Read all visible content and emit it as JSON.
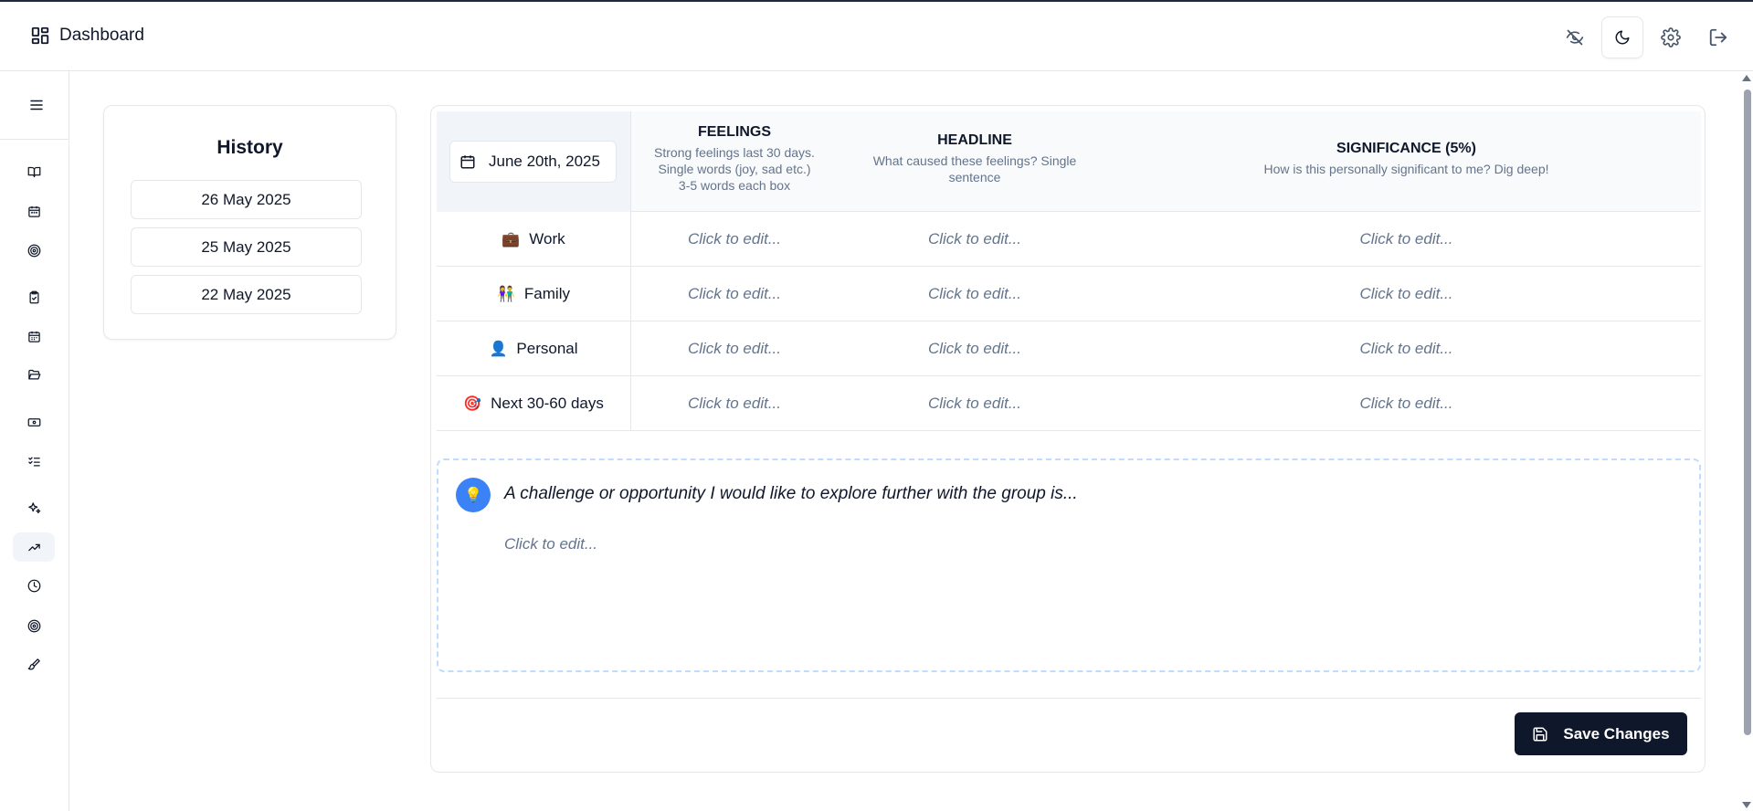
{
  "header": {
    "title": "Dashboard",
    "icons": [
      "dashboard-icon",
      "eye-off-icon",
      "moon-icon",
      "gear-icon",
      "logout-icon"
    ]
  },
  "sidebar": {
    "items": [
      {
        "icon": "book-icon"
      },
      {
        "icon": "calendar-icon"
      },
      {
        "icon": "target-icon"
      },
      {
        "icon": "clipboard-check-icon"
      },
      {
        "icon": "calendar-days-icon"
      },
      {
        "icon": "folder-open-icon"
      },
      {
        "icon": "banknote-icon"
      },
      {
        "icon": "list-checks-icon"
      },
      {
        "icon": "sparkles-icon"
      },
      {
        "icon": "trending-up-icon",
        "active": true
      },
      {
        "icon": "clock-icon"
      },
      {
        "icon": "target-icon"
      },
      {
        "icon": "brush-icon"
      }
    ]
  },
  "history": {
    "title": "History",
    "dates": [
      "26 May 2025",
      "25 May 2025",
      "22 May 2025"
    ]
  },
  "table": {
    "date": "June 20th, 2025",
    "columns": [
      {
        "title": "FEELINGS",
        "subtitle_lines": [
          "Strong feelings last 30 days.",
          "Single words (joy, sad etc.)",
          "3-5 words each box"
        ]
      },
      {
        "title": "HEADLINE",
        "subtitle_lines": [
          "What caused these feelings? Single",
          "sentence"
        ]
      },
      {
        "title": "SIGNIFICANCE (5%)",
        "subtitle_lines": [
          "How is this personally significant to me? Dig deep!"
        ]
      }
    ],
    "rows": [
      {
        "emoji": "💼",
        "label": "Work"
      },
      {
        "emoji": "👫",
        "label": "Family"
      },
      {
        "emoji": "👤",
        "label": "Personal"
      },
      {
        "emoji": "🎯",
        "label": "Next 30-60 days"
      }
    ],
    "placeholder": "Click to edit..."
  },
  "challenge": {
    "emoji": "💡",
    "title": "A challenge or opportunity I would like to explore further with the group is...",
    "placeholder": "Click to edit..."
  },
  "save": {
    "label": "Save Changes"
  },
  "colors": {
    "primary": "#0f172a",
    "muted": "#64748b",
    "accent": "#3b82f6",
    "border": "#e5e7eb"
  }
}
